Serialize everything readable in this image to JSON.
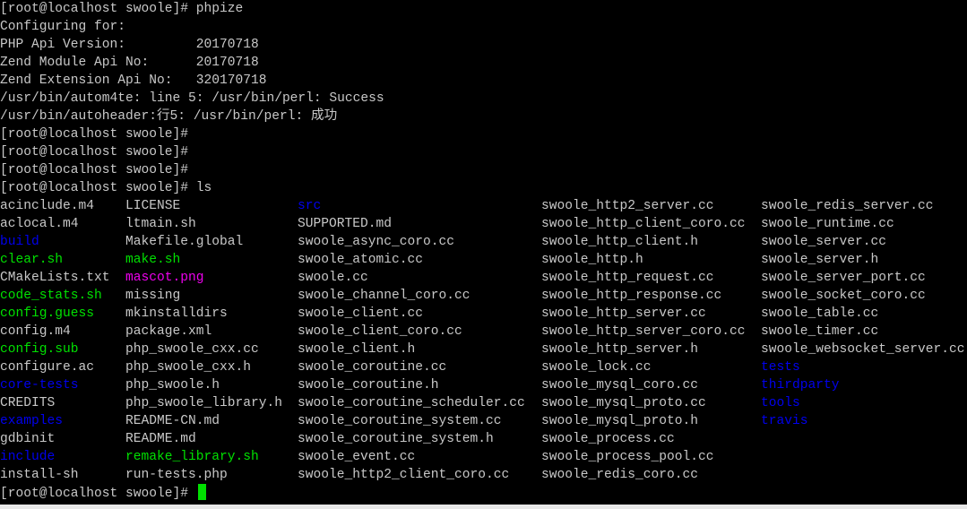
{
  "colors": {
    "text": "#c8c8c8",
    "directory": "#0000ee",
    "executable": "#00e000",
    "image": "#ee00ee",
    "cursor": "#00e000",
    "background": "#000000"
  },
  "output_lines": [
    "[root@localhost swoole]# phpize",
    "Configuring for:",
    "PHP Api Version:         20170718",
    "Zend Module Api No:      20170718",
    "Zend Extension Api No:   320170718",
    "/usr/bin/autom4te: line 5: /usr/bin/perl: Success",
    "/usr/bin/autoheader:行5: /usr/bin/perl: 成功",
    "[root@localhost swoole]#",
    "[root@localhost swoole]#",
    "[root@localhost swoole]#",
    "[root@localhost swoole]# ls"
  ],
  "ls_columns": [
    [
      {
        "name": "acinclude.m4",
        "type": "file"
      },
      {
        "name": "aclocal.m4",
        "type": "file"
      },
      {
        "name": "build",
        "type": "dir"
      },
      {
        "name": "clear.sh",
        "type": "exec"
      },
      {
        "name": "CMakeLists.txt",
        "type": "file"
      },
      {
        "name": "code_stats.sh",
        "type": "exec"
      },
      {
        "name": "config.guess",
        "type": "exec"
      },
      {
        "name": "config.m4",
        "type": "file"
      },
      {
        "name": "config.sub",
        "type": "exec"
      },
      {
        "name": "configure.ac",
        "type": "file"
      },
      {
        "name": "core-tests",
        "type": "dir"
      },
      {
        "name": "CREDITS",
        "type": "file"
      },
      {
        "name": "examples",
        "type": "dir"
      },
      {
        "name": "gdbinit",
        "type": "file"
      },
      {
        "name": "include",
        "type": "dir"
      },
      {
        "name": "install-sh",
        "type": "file"
      }
    ],
    [
      {
        "name": "LICENSE",
        "type": "file"
      },
      {
        "name": "ltmain.sh",
        "type": "file"
      },
      {
        "name": "Makefile.global",
        "type": "file"
      },
      {
        "name": "make.sh",
        "type": "exec"
      },
      {
        "name": "mascot.png",
        "type": "image"
      },
      {
        "name": "missing",
        "type": "file"
      },
      {
        "name": "mkinstalldirs",
        "type": "file"
      },
      {
        "name": "package.xml",
        "type": "file"
      },
      {
        "name": "php_swoole_cxx.cc",
        "type": "file"
      },
      {
        "name": "php_swoole_cxx.h",
        "type": "file"
      },
      {
        "name": "php_swoole.h",
        "type": "file"
      },
      {
        "name": "php_swoole_library.h",
        "type": "file"
      },
      {
        "name": "README-CN.md",
        "type": "file"
      },
      {
        "name": "README.md",
        "type": "file"
      },
      {
        "name": "remake_library.sh",
        "type": "exec"
      },
      {
        "name": "run-tests.php",
        "type": "file"
      }
    ],
    [
      {
        "name": "src",
        "type": "dir"
      },
      {
        "name": "SUPPORTED.md",
        "type": "file"
      },
      {
        "name": "swoole_async_coro.cc",
        "type": "file"
      },
      {
        "name": "swoole_atomic.cc",
        "type": "file"
      },
      {
        "name": "swoole.cc",
        "type": "file"
      },
      {
        "name": "swoole_channel_coro.cc",
        "type": "file"
      },
      {
        "name": "swoole_client.cc",
        "type": "file"
      },
      {
        "name": "swoole_client_coro.cc",
        "type": "file"
      },
      {
        "name": "swoole_client.h",
        "type": "file"
      },
      {
        "name": "swoole_coroutine.cc",
        "type": "file"
      },
      {
        "name": "swoole_coroutine.h",
        "type": "file"
      },
      {
        "name": "swoole_coroutine_scheduler.cc",
        "type": "file"
      },
      {
        "name": "swoole_coroutine_system.cc",
        "type": "file"
      },
      {
        "name": "swoole_coroutine_system.h",
        "type": "file"
      },
      {
        "name": "swoole_event.cc",
        "type": "file"
      },
      {
        "name": "swoole_http2_client_coro.cc",
        "type": "file"
      }
    ],
    [
      {
        "name": "swoole_http2_server.cc",
        "type": "file"
      },
      {
        "name": "swoole_http_client_coro.cc",
        "type": "file"
      },
      {
        "name": "swoole_http_client.h",
        "type": "file"
      },
      {
        "name": "swoole_http.h",
        "type": "file"
      },
      {
        "name": "swoole_http_request.cc",
        "type": "file"
      },
      {
        "name": "swoole_http_response.cc",
        "type": "file"
      },
      {
        "name": "swoole_http_server.cc",
        "type": "file"
      },
      {
        "name": "swoole_http_server_coro.cc",
        "type": "file"
      },
      {
        "name": "swoole_http_server.h",
        "type": "file"
      },
      {
        "name": "swoole_lock.cc",
        "type": "file"
      },
      {
        "name": "swoole_mysql_coro.cc",
        "type": "file"
      },
      {
        "name": "swoole_mysql_proto.cc",
        "type": "file"
      },
      {
        "name": "swoole_mysql_proto.h",
        "type": "file"
      },
      {
        "name": "swoole_process.cc",
        "type": "file"
      },
      {
        "name": "swoole_process_pool.cc",
        "type": "file"
      },
      {
        "name": "swoole_redis_coro.cc",
        "type": "file"
      }
    ],
    [
      {
        "name": "swoole_redis_server.cc",
        "type": "file"
      },
      {
        "name": "swoole_runtime.cc",
        "type": "file"
      },
      {
        "name": "swoole_server.cc",
        "type": "file"
      },
      {
        "name": "swoole_server.h",
        "type": "file"
      },
      {
        "name": "swoole_server_port.cc",
        "type": "file"
      },
      {
        "name": "swoole_socket_coro.cc",
        "type": "file"
      },
      {
        "name": "swoole_table.cc",
        "type": "file"
      },
      {
        "name": "swoole_timer.cc",
        "type": "file"
      },
      {
        "name": "swoole_websocket_server.cc",
        "type": "file"
      },
      {
        "name": "tests",
        "type": "dir"
      },
      {
        "name": "thirdparty",
        "type": "dir"
      },
      {
        "name": "tools",
        "type": "dir"
      },
      {
        "name": "travis",
        "type": "dir"
      }
    ]
  ],
  "final_prompt": "[root@localhost swoole]# "
}
